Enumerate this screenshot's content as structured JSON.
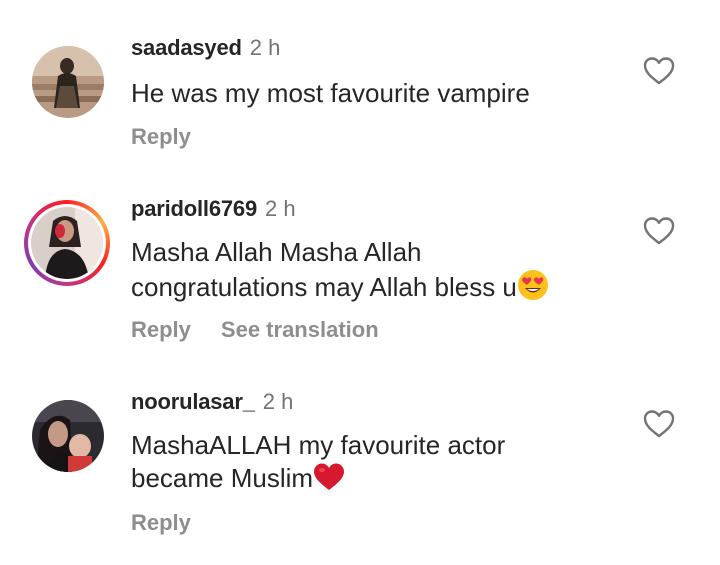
{
  "comments": [
    {
      "username": "saadasyed",
      "time": "2 h",
      "text_lines": [
        "He was my most favourite vampire"
      ],
      "actions": [
        "Reply"
      ],
      "avatar_story_ring": false,
      "icons": {
        "like": "heart-outline-icon"
      }
    },
    {
      "username": "paridoll6769",
      "time": "2 h",
      "text_lines": [
        "Masha Allah Masha Allah",
        "congratulations may Allah bless u"
      ],
      "emoji": "heart-eyes-emoji",
      "actions": [
        "Reply",
        "See translation"
      ],
      "avatar_story_ring": true,
      "icons": {
        "like": "heart-outline-icon"
      }
    },
    {
      "username": "noorulasar_",
      "time": "2 h",
      "text_lines": [
        "MashaALLAH my favourite actor",
        "became Muslim"
      ],
      "emoji": "red-heart-emoji",
      "actions": [
        "Reply"
      ],
      "avatar_story_ring": false,
      "icons": {
        "like": "heart-outline-icon"
      }
    }
  ],
  "colors": {
    "text": "#262626",
    "secondary": "#737373",
    "action": "#8e8e8e",
    "story_ring_start": "#fcb045",
    "story_ring_end": "#c13584"
  }
}
